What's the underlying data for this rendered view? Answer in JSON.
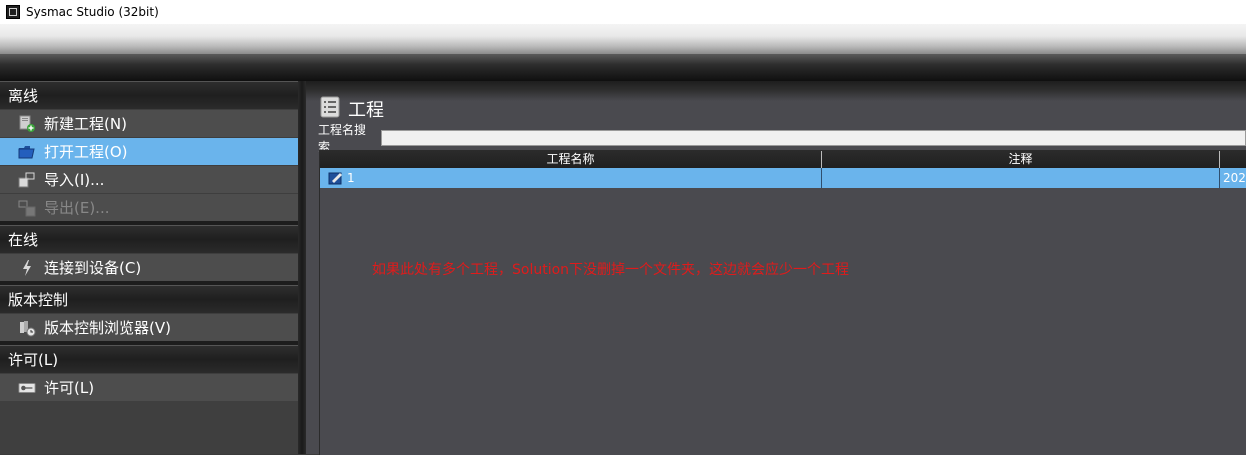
{
  "window": {
    "title": "Sysmac Studio (32bit)"
  },
  "sidebar": {
    "offline": {
      "header": "离线",
      "items": [
        {
          "label": "新建工程(N)",
          "icon": "new-project-icon",
          "state": "normal"
        },
        {
          "label": "打开工程(O)",
          "icon": "open-folder-icon",
          "state": "selected"
        },
        {
          "label": "导入(I)...",
          "icon": "import-icon",
          "state": "normal"
        },
        {
          "label": "导出(E)...",
          "icon": "export-icon",
          "state": "disabled"
        }
      ]
    },
    "online": {
      "header": "在线",
      "items": [
        {
          "label": "连接到设备(C)",
          "icon": "lightning-icon"
        }
      ]
    },
    "version_control": {
      "header": "版本控制",
      "items": [
        {
          "label": "版本控制浏览器(V)",
          "icon": "version-control-icon"
        }
      ]
    },
    "license": {
      "header": "许可(L)",
      "items": [
        {
          "label": "许可(L)",
          "icon": "key-icon"
        }
      ]
    }
  },
  "main": {
    "title": "工程",
    "search_label": "工程名搜索",
    "search_value": "",
    "table": {
      "columns": [
        "工程名称",
        "注释",
        ""
      ],
      "rows": [
        {
          "name": "1",
          "comment": "",
          "date": "202"
        }
      ]
    },
    "annotation": "如果此处有多个工程，Solution下没删掉一个文件夹，这边就会应少一个工程"
  },
  "colors": {
    "selection": "#6ab4ec",
    "annotation": "#e01b1b",
    "panel_bg": "#4d4d4d"
  }
}
